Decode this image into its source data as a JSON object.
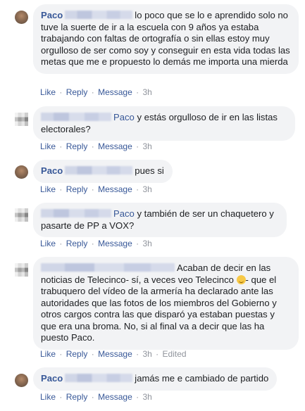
{
  "comments": [
    {
      "author": "Paco",
      "text": "lo poco que se lo e aprendido solo no tuve la suerte de ir a la escuela con 9 años ya estaba trabajando con faltas de ortografía o sin ellas estoy muy orgulloso de ser como soy y conseguir en esta vida todas las metas que me e propuesto lo demás me importa una mierda",
      "time": "3h"
    },
    {
      "mention": "Paco",
      "text": "y estás orgulloso de ir en las listas electorales?",
      "time": "3h"
    },
    {
      "author": "Paco",
      "text": "pues si",
      "time": "3h"
    },
    {
      "mention": "Paco",
      "text": "y también de ser un chaquetero y pasarte de PP a VOX?",
      "time": "3h"
    },
    {
      "text_a": "Acaban de decir en las noticias de Telecinco- sí, a veces veo Telecinco",
      "text_b": "- que el trabuquero del vídeo de la armería ha declarado ante las autoridades que las fotos de los miembros del Gobierno y otros cargos contra las que disparó ya estaban puestas y que era una broma. No, si al final va a decir que las ha puesto Paco.",
      "time": "3h",
      "edited": "Edited"
    },
    {
      "author": "Paco",
      "text": "jamás me e cambiado de partido",
      "time": "3h"
    }
  ],
  "actions": {
    "like": "Like",
    "reply": "Reply",
    "message": "Message",
    "separator": "·"
  },
  "icons": {
    "emoji": "smirk-emoji-icon"
  }
}
